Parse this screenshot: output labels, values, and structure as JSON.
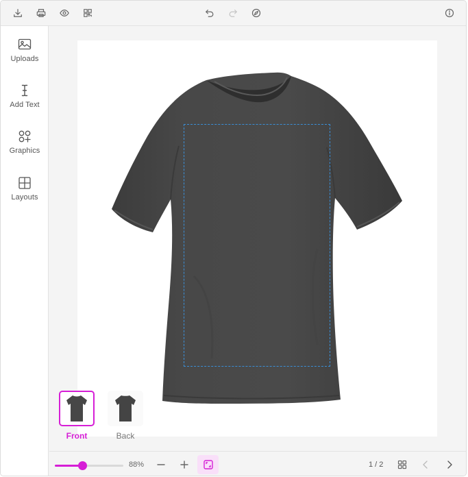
{
  "toolbar": {
    "left_icons": [
      "download-icon",
      "print-icon",
      "preview-eye-icon",
      "qr-code-icon"
    ],
    "center_icons": [
      "undo-icon",
      "redo-icon",
      "compass-icon"
    ],
    "right_icons": [
      "info-icon"
    ]
  },
  "sidebar": {
    "items": [
      {
        "label": "Uploads",
        "icon": "image-icon"
      },
      {
        "label": "Add Text",
        "icon": "text-cursor-icon"
      },
      {
        "label": "Graphics",
        "icon": "shapes-icon"
      },
      {
        "label": "Layouts",
        "icon": "grid-layout-icon"
      }
    ]
  },
  "views": [
    {
      "label": "Front",
      "active": true
    },
    {
      "label": "Back",
      "active": false
    }
  ],
  "bottombar": {
    "zoom_value": "88%",
    "zoom_fraction": 0.4,
    "page_indicator": "1 / 2"
  },
  "colors": {
    "accent": "#d61ed6",
    "shirt": "#474747",
    "print_area": "#3a8fd8"
  }
}
